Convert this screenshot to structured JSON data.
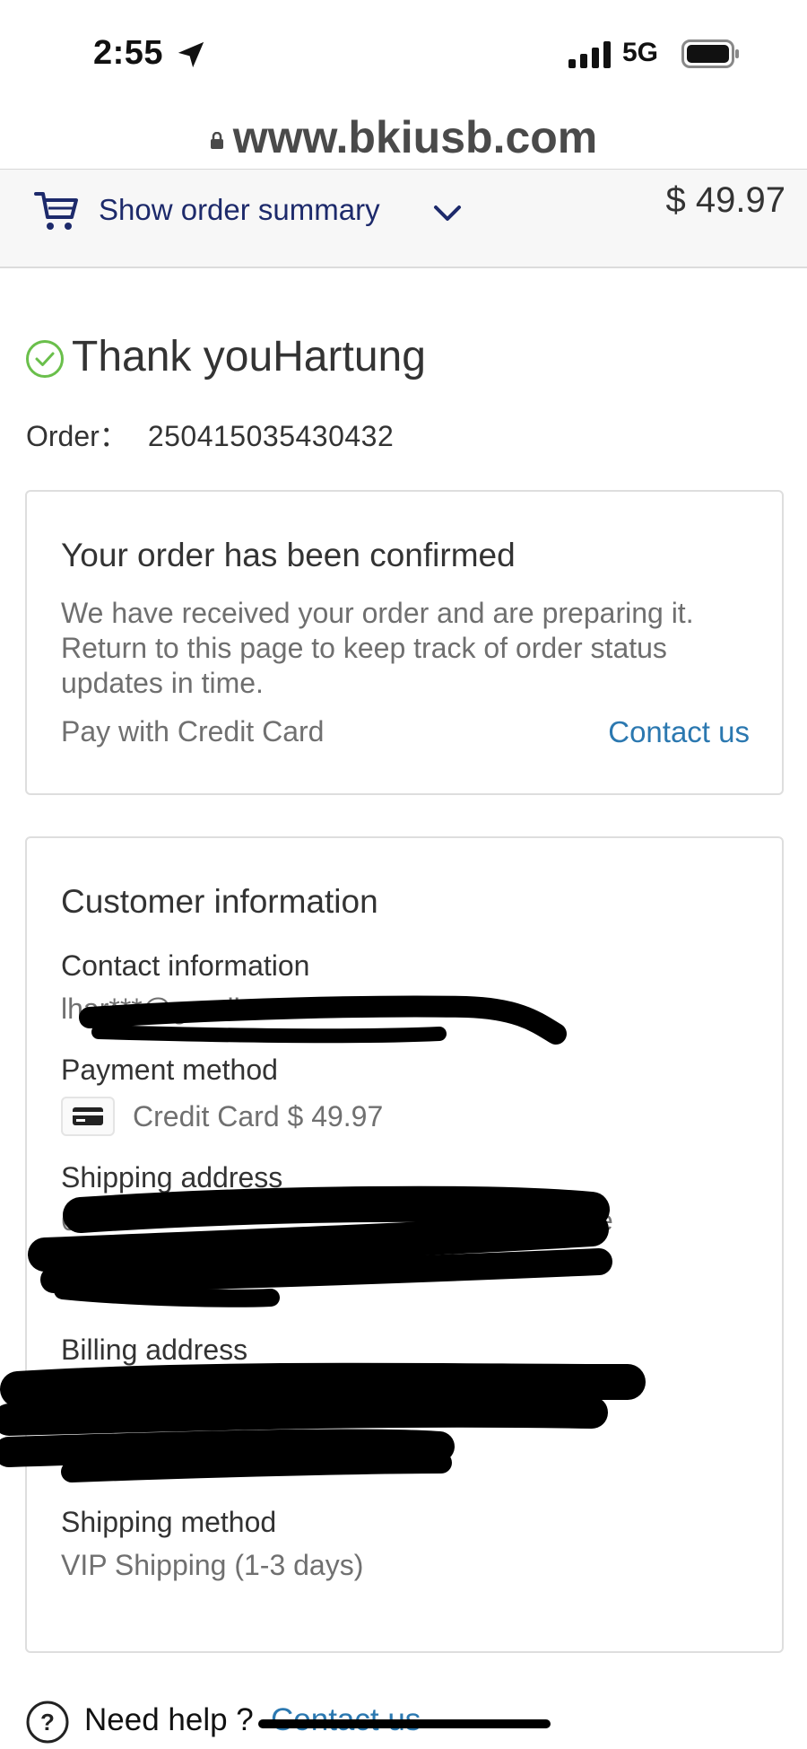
{
  "status_bar": {
    "time": "2:55",
    "network": "5G",
    "icons": [
      "location-arrow-icon",
      "signal-icon",
      "battery-icon"
    ]
  },
  "browser": {
    "url": "www.bkiusb.com",
    "icon": "lock-icon"
  },
  "order_summary_bar": {
    "label": "Show order summary",
    "price": "$ 49.97",
    "icons": [
      "cart-icon",
      "chevron-down-icon"
    ]
  },
  "thank_you": {
    "title": "Thank youHartung",
    "order_label": "Order：",
    "order_number": "250415035430432",
    "icon": "check-circle-icon",
    "icon_color": "#6abf4b"
  },
  "confirmation_card": {
    "title": "Your order has been confirmed",
    "message": "We have received your order and are preparing it. Return to this page to keep track of order status updates in time.",
    "payment_note": "Pay with Credit Card",
    "contact_link": "Contact us"
  },
  "customer_info": {
    "title": "Customer information",
    "contact_label": "Contact information",
    "email": "lhar***@gmail.com",
    "payment_label": "Payment method",
    "payment_value": "Credit Card $ 49.97",
    "payment_icon": "credit-card-icon",
    "shipping_address_label": "Shipping address",
    "shipping_address_visible": "6",
    "shipping_address_visible_end": "e",
    "billing_address_label": "Billing address",
    "shipping_method_label": "Shipping method",
    "shipping_method_value": "VIP Shipping (1-3 days)"
  },
  "help": {
    "text": "Need help ?",
    "link": "Contact us",
    "icon": "question-circle-icon"
  },
  "colors": {
    "link": "#2b78b0",
    "summary_text": "#1d2a6b",
    "success": "#6abf4b"
  }
}
